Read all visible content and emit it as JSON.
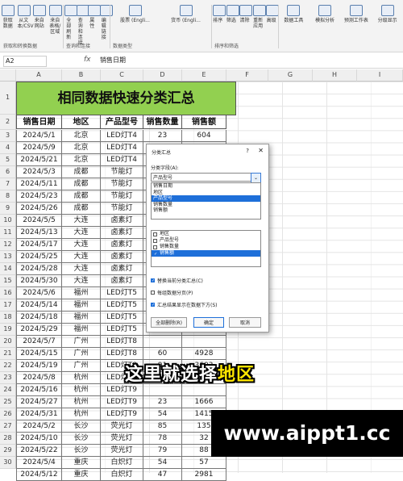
{
  "ribbon": {
    "groups": [
      {
        "label": "获取和转换数据",
        "buttons": [
          "获取数据",
          "从文本/CSV",
          "来自网站",
          "来自表格/区域"
        ]
      },
      {
        "label": "查询和连接",
        "buttons": [
          "全部刷新",
          "查询和连接",
          "属性",
          "编辑链接"
        ]
      },
      {
        "label": "数据类型",
        "buttons": [
          "股票 (Engli...",
          "货币 (Engli..."
        ]
      },
      {
        "label": "排序和筛选",
        "buttons": [
          "排序",
          "筛选",
          "清除",
          "重新应用",
          "高级"
        ]
      },
      {
        "label": "",
        "buttons": [
          "数据工具",
          "模拟分析",
          "预测工作表",
          "分级显示"
        ]
      }
    ]
  },
  "formula_bar": {
    "name_box": "A2",
    "fx": "fx",
    "value": "销售日期"
  },
  "columns": [
    "A",
    "B",
    "C",
    "D",
    "E",
    "F",
    "G",
    "H",
    "I"
  ],
  "sheet": {
    "title": "相同数据快速分类汇总",
    "headers": [
      "销售日期",
      "地区",
      "产品型号",
      "销售数量",
      "销售额"
    ],
    "rows": [
      [
        "2024/5/1",
        "北京",
        "LED灯T4",
        "23",
        "604"
      ],
      [
        "2024/5/9",
        "北京",
        "LED灯T4",
        "",
        ""
      ],
      [
        "2024/5/21",
        "北京",
        "LED灯T4",
        "",
        ""
      ],
      [
        "2024/5/3",
        "成都",
        "节能灯",
        "",
        ""
      ],
      [
        "2024/5/11",
        "成都",
        "节能灯",
        "",
        ""
      ],
      [
        "2024/5/23",
        "成都",
        "节能灯",
        "",
        ""
      ],
      [
        "2024/5/26",
        "成都",
        "节能灯",
        "",
        ""
      ],
      [
        "2024/5/5",
        "大连",
        "卤素灯",
        "",
        ""
      ],
      [
        "2024/5/13",
        "大连",
        "卤素灯",
        "",
        ""
      ],
      [
        "2024/5/17",
        "大连",
        "卤素灯",
        "",
        ""
      ],
      [
        "2024/5/25",
        "大连",
        "卤素灯",
        "",
        ""
      ],
      [
        "2024/5/28",
        "大连",
        "卤素灯",
        "",
        ""
      ],
      [
        "2024/5/30",
        "大连",
        "卤素灯",
        "",
        ""
      ],
      [
        "2024/5/6",
        "福州",
        "LED灯T5",
        "",
        ""
      ],
      [
        "2024/5/14",
        "福州",
        "LED灯T5",
        "",
        ""
      ],
      [
        "2024/5/18",
        "福州",
        "LED灯T5",
        "",
        ""
      ],
      [
        "2024/5/29",
        "福州",
        "LED灯T5",
        "",
        ""
      ],
      [
        "2024/5/7",
        "广州",
        "LED灯T8",
        "",
        ""
      ],
      [
        "2024/5/15",
        "广州",
        "LED灯T8",
        "60",
        "4928"
      ],
      [
        "2024/5/19",
        "广州",
        "LED灯T8",
        "91",
        "3603"
      ],
      [
        "2024/5/8",
        "杭州",
        "LED灯T9",
        "",
        ""
      ],
      [
        "2024/5/16",
        "杭州",
        "LED灯T9",
        "",
        ""
      ],
      [
        "2024/5/27",
        "杭州",
        "LED灯T9",
        "23",
        "1666"
      ],
      [
        "2024/5/31",
        "杭州",
        "LED灯T9",
        "54",
        "1415"
      ],
      [
        "2024/5/2",
        "长沙",
        "荧光灯",
        "85",
        "135"
      ],
      [
        "2024/5/10",
        "长沙",
        "荧光灯",
        "78",
        "32"
      ],
      [
        "2024/5/22",
        "长沙",
        "荧光灯",
        "79",
        "88"
      ],
      [
        "2024/5/4",
        "重庆",
        "白炽灯",
        "54",
        "57"
      ],
      [
        "2024/5/12",
        "重庆",
        "白炽灯",
        "47",
        "2981"
      ],
      [
        "2024/5/24",
        "重庆",
        "白炽灯",
        "49",
        "4837"
      ]
    ]
  },
  "dialog": {
    "title": "分类汇总",
    "help": "?",
    "close": "✕",
    "group_by_label": "分类字段(A):",
    "group_by_value": "产品型号",
    "dropdown_arrow": "⌄",
    "dropdown_items": [
      "销售日期",
      "地区",
      "产品型号",
      "销售数量",
      "销售额"
    ],
    "dropdown_selected_index": 2,
    "subtotal_items": [
      {
        "label": "地区",
        "checked": false
      },
      {
        "label": "产品型号",
        "checked": false
      },
      {
        "label": "销售数量",
        "checked": false
      },
      {
        "label": "销售额",
        "checked": true
      }
    ],
    "options": [
      {
        "label": "替换当前分类汇总(C)",
        "checked": true
      },
      {
        "label": "每组数据分页(P)",
        "checked": false
      },
      {
        "label": "汇总结果显示在数据下方(S)",
        "checked": true
      }
    ],
    "buttons": {
      "remove_all": "全部删除(R)",
      "ok": "确定",
      "cancel": "取消"
    }
  },
  "caption": {
    "before": "这里就选择",
    "highlight": "地区"
  },
  "watermark": "www.aippt1.cc"
}
